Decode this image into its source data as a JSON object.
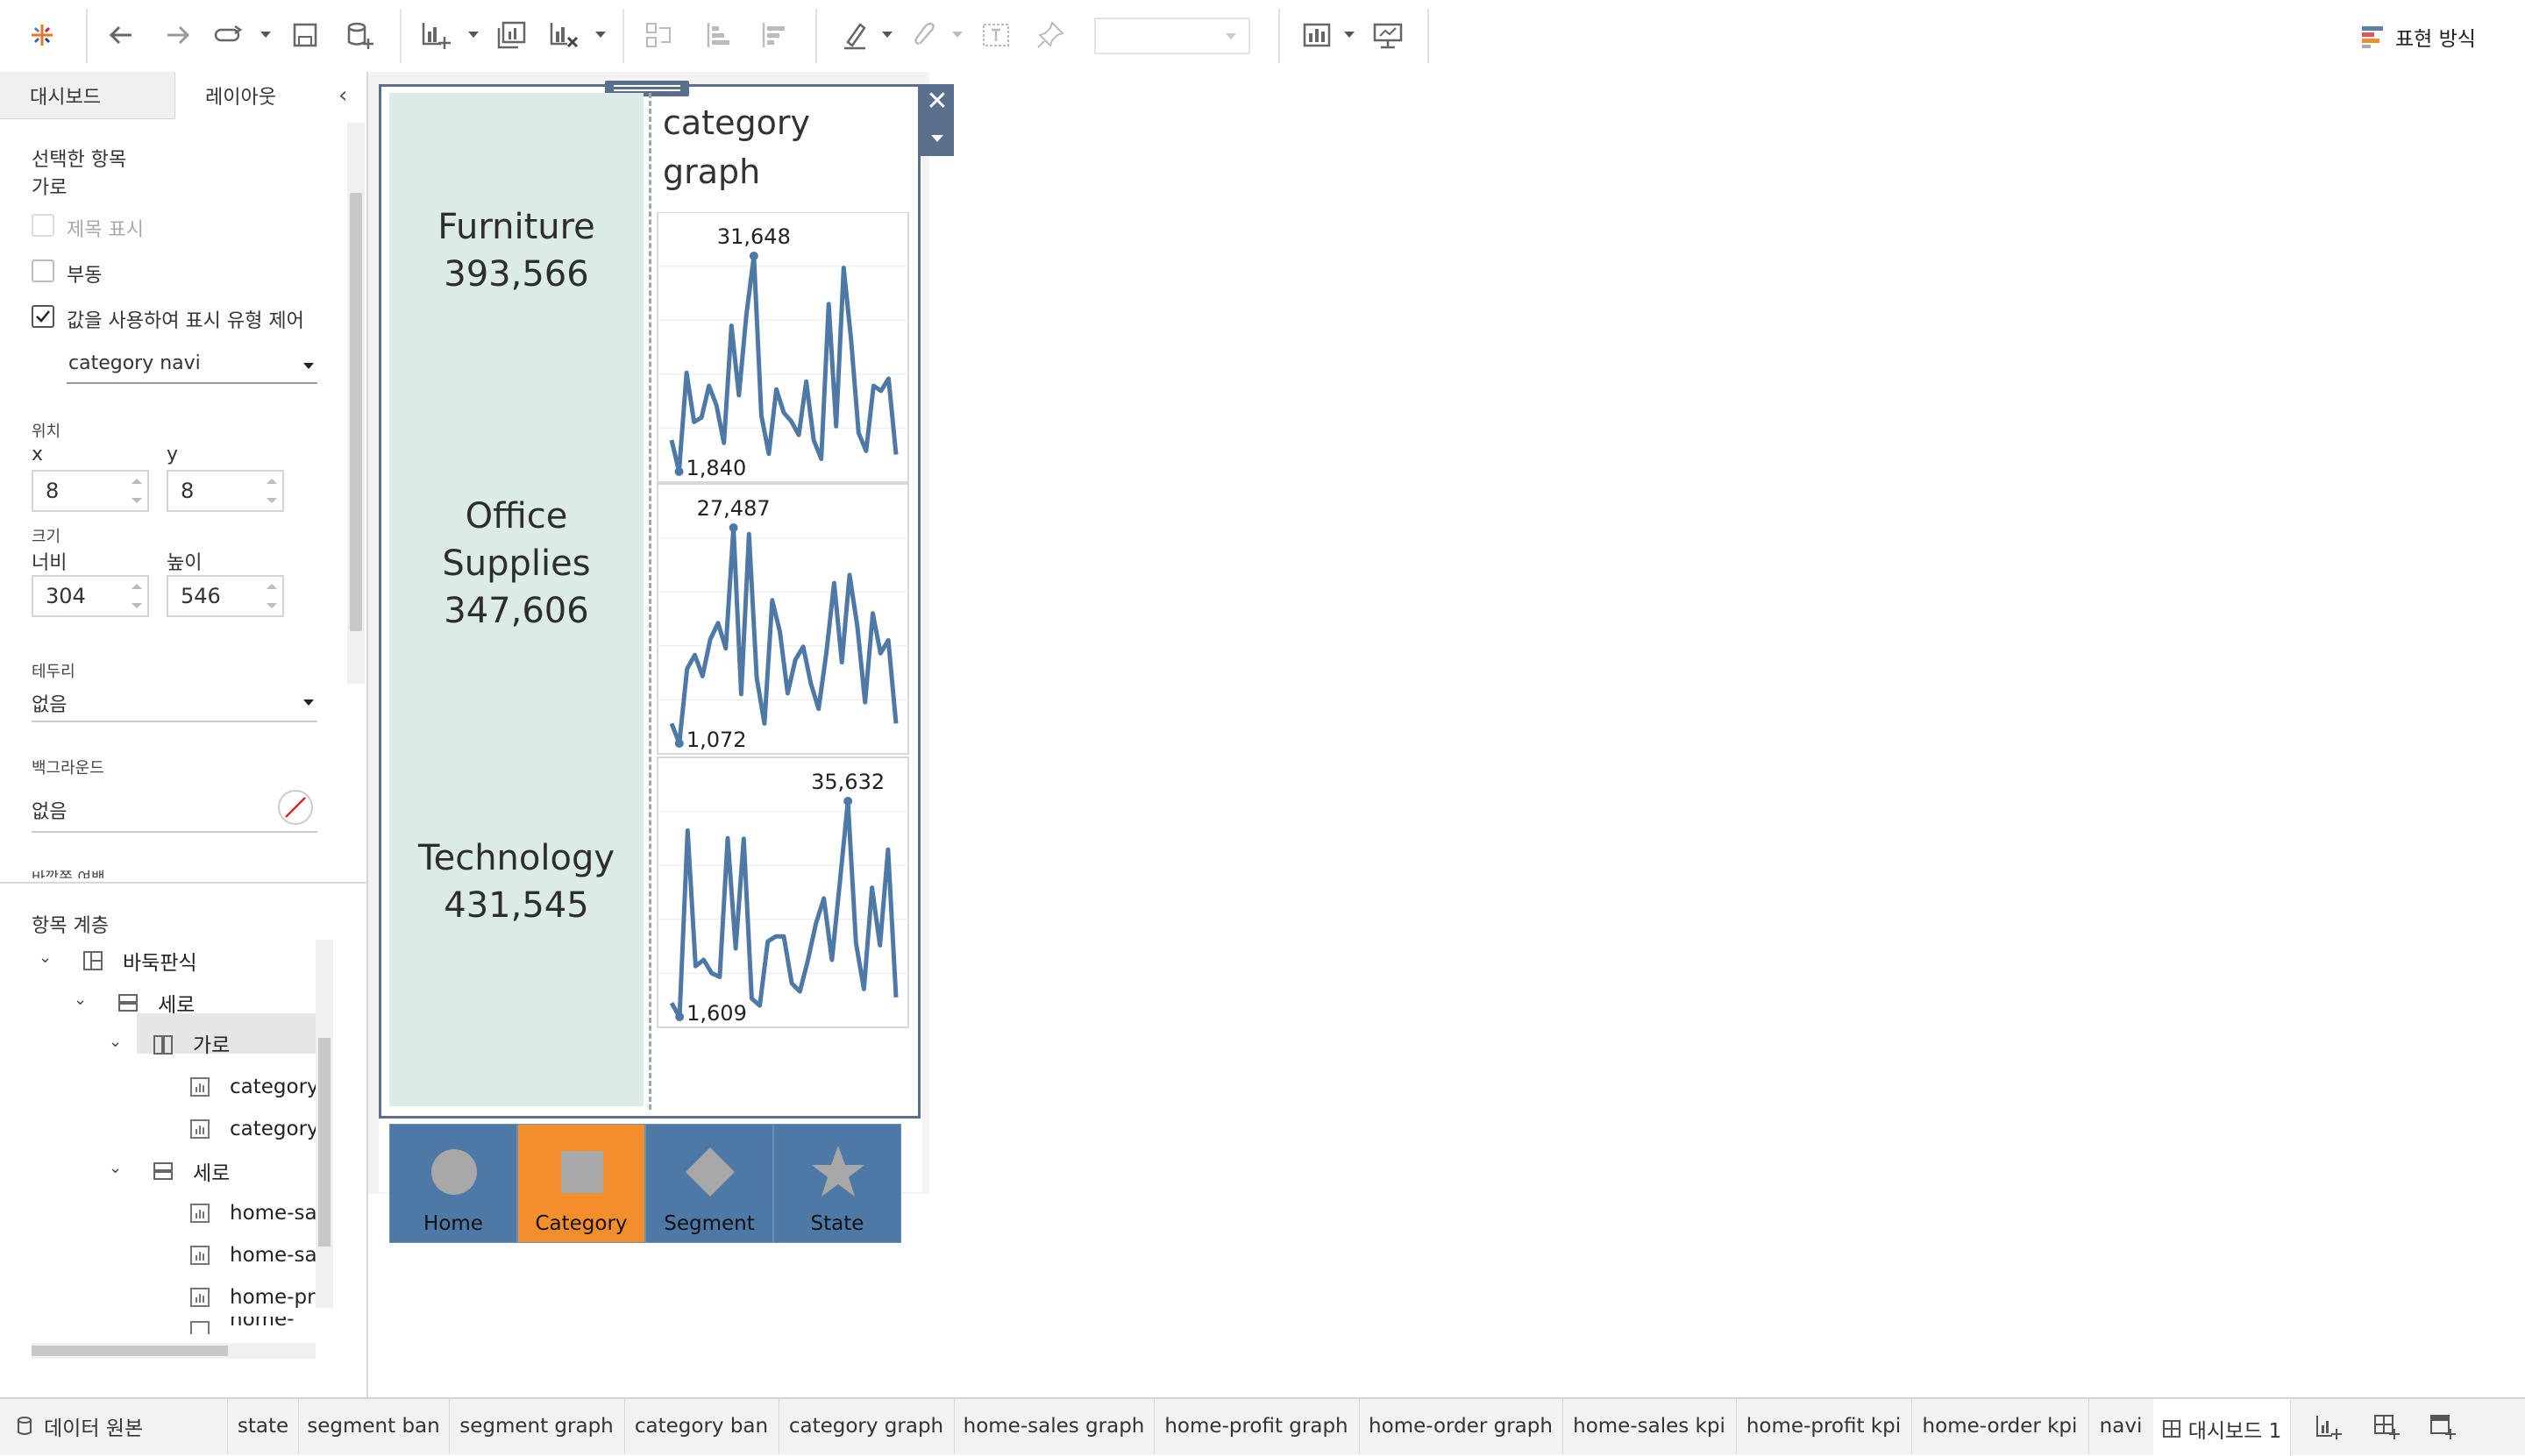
{
  "toolbar": {
    "icons": [
      "tableau-logo-icon",
      "undo-icon",
      "redo-icon",
      "replay-icon",
      "save-icon",
      "new-datasource-icon",
      "new-sheet-icon",
      "duplicate-sheet-icon",
      "clear-sheet-icon",
      "swap-icon",
      "sort-asc-icon",
      "sort-desc-icon",
      "highlight-icon",
      "attach-icon",
      "label-icon",
      "pin-icon",
      "chart-type-icon",
      "presentation-icon"
    ],
    "show_me_label": "표현 방식"
  },
  "left_panel": {
    "tabs": [
      "대시보드",
      "레이아웃"
    ],
    "active_tab": "레이아웃",
    "selected_item_heading": "선택한 항목",
    "selected_item_name": "가로",
    "options": [
      {
        "label": "제목 표시",
        "checked": false,
        "disabled": true
      },
      {
        "label": "부동",
        "checked": false,
        "disabled": false
      },
      {
        "label": "값을 사용하여 표시 유형 제어",
        "checked": true,
        "disabled": false
      }
    ],
    "control_value": "category navi",
    "position_label": "위치",
    "x_label": "x",
    "y_label": "y",
    "x_value": "8",
    "y_value": "8",
    "size_label": "크기",
    "width_label": "너비",
    "height_label": "높이",
    "width_value": "304",
    "height_value": "546",
    "border_label": "테두리",
    "border_value": "없음",
    "background_label": "백그라운드",
    "background_value": "없음",
    "outer_padding_label": "바깥쪽 여백",
    "hierarchy_heading": "항목 계층",
    "tree": [
      {
        "label": "바둑판식",
        "level": 0,
        "expanded": true
      },
      {
        "label": "세로",
        "level": 1,
        "expanded": true
      },
      {
        "label": "가로",
        "level": 2,
        "expanded": true,
        "selected": true
      },
      {
        "label": "category",
        "level": 3
      },
      {
        "label": "category",
        "level": 3
      },
      {
        "label": "세로",
        "level": 2,
        "expanded": true
      },
      {
        "label": "home-sal",
        "level": 3
      },
      {
        "label": "home-sal",
        "level": 3
      },
      {
        "label": "home-prc",
        "level": 3
      },
      {
        "label": "home-prc",
        "level": 3
      }
    ]
  },
  "dashboard": {
    "graph_title": "category graph",
    "graph_title_line1": "category",
    "graph_title_line2": "graph",
    "categories": [
      {
        "name_lines": [
          "Furniture"
        ],
        "value": "393,566"
      },
      {
        "name_lines": [
          "Office",
          "Supplies"
        ],
        "value": "347,606"
      },
      {
        "name_lines": [
          "Technology"
        ],
        "value": "431,545"
      }
    ],
    "nav_buttons": [
      {
        "label": "Home",
        "shape": "circle",
        "active": false
      },
      {
        "label": "Category",
        "shape": "square",
        "active": true
      },
      {
        "label": "Segment",
        "shape": "diamond",
        "active": false
      },
      {
        "label": "State",
        "shape": "star",
        "active": false
      }
    ],
    "colors": {
      "kpi_bg": "#dcebe7",
      "line": "#4e79a7",
      "nav_blue": "#4e79a7",
      "nav_active": "#f28e2b",
      "frame": "#5a6f8c"
    }
  },
  "chart_data": {
    "type": "line",
    "series": [
      {
        "name": "Furniture",
        "max_label": "31,648",
        "min_label": "1,840",
        "values": [
          6200,
          1840,
          15500,
          8700,
          9300,
          13700,
          11000,
          5800,
          22000,
          12400,
          23500,
          31648,
          9600,
          4300,
          13200,
          10000,
          8800,
          6900,
          14300,
          6200,
          3600,
          25000,
          8100,
          30000,
          20000,
          7200,
          4700,
          13700,
          13000,
          14700,
          4200
        ]
      },
      {
        "name": "Office Supplies",
        "max_label": "27,487",
        "min_label": "1,072",
        "values": [
          3500,
          1072,
          10200,
          11900,
          9300,
          13800,
          15800,
          12700,
          27487,
          7100,
          26700,
          9100,
          3500,
          18600,
          14700,
          7200,
          11300,
          12900,
          8400,
          5300,
          12200,
          20700,
          11000,
          21700,
          15400,
          6100,
          17000,
          12100,
          13700,
          3500
        ]
      },
      {
        "name": "Technology",
        "max_label": "35,632",
        "min_label": "1,609",
        "values": [
          3800,
          1609,
          31000,
          9600,
          10600,
          8500,
          7900,
          29800,
          12400,
          29700,
          4500,
          3400,
          13500,
          14300,
          14300,
          6900,
          5600,
          10500,
          16300,
          20300,
          10600,
          22900,
          35632,
          13300,
          6000,
          22000,
          12900,
          28000,
          4700
        ]
      }
    ]
  },
  "bottom_tabs": {
    "datasource_label": "데이터 원본",
    "sheets": [
      "state",
      "segment ban",
      "segment graph",
      "category ban",
      "category graph",
      "home-sales graph",
      "home-profit graph",
      "home-order graph",
      "home-sales kpi",
      "home-profit kpi",
      "home-order kpi",
      "navi",
      "대시보드 1"
    ],
    "active_sheet": "대시보드 1"
  }
}
